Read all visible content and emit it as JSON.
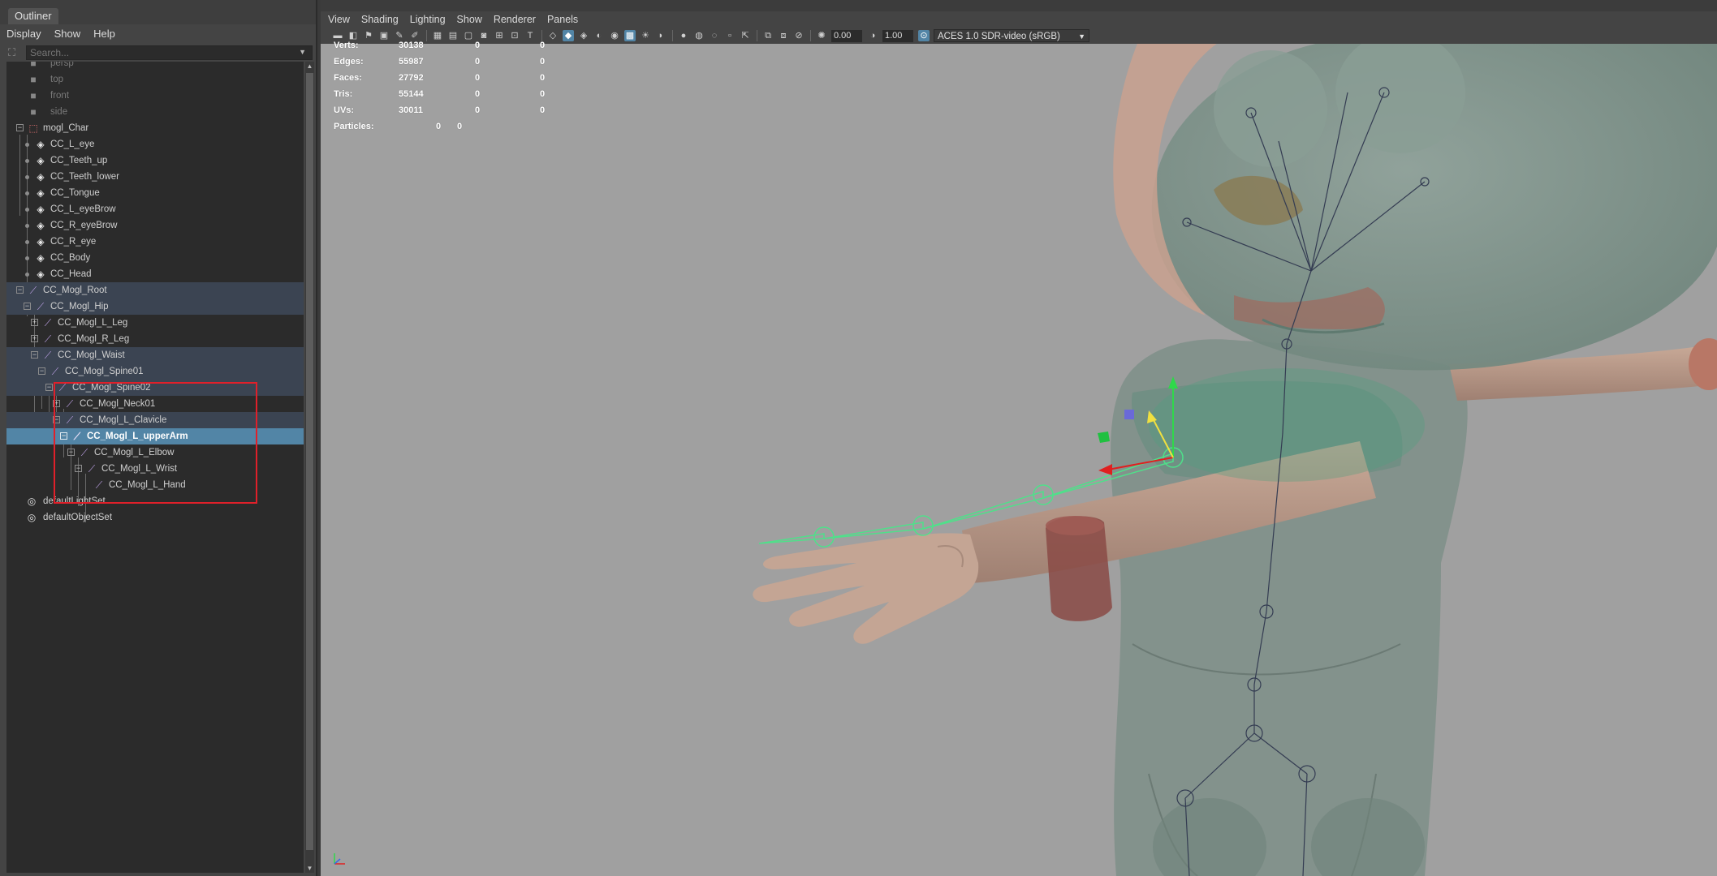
{
  "outliner": {
    "tab_label": "Outliner",
    "menu": [
      "Display",
      "Show",
      "Help"
    ],
    "search_placeholder": "Search...",
    "items": [
      {
        "label": "persp",
        "icon": "camera-icon"
      },
      {
        "label": "top",
        "icon": "camera-icon"
      },
      {
        "label": "front",
        "icon": "camera-icon"
      },
      {
        "label": "side",
        "icon": "camera-icon"
      },
      {
        "label": "mogl_Char",
        "icon": "group-icon"
      },
      {
        "label": "CC_L_eye",
        "icon": "mesh-icon"
      },
      {
        "label": "CC_Teeth_up",
        "icon": "mesh-icon"
      },
      {
        "label": "CC_Teeth_lower",
        "icon": "mesh-icon"
      },
      {
        "label": "CC_Tongue",
        "icon": "mesh-icon"
      },
      {
        "label": "CC_L_eyeBrow",
        "icon": "mesh-icon"
      },
      {
        "label": "CC_R_eyeBrow",
        "icon": "mesh-icon"
      },
      {
        "label": "CC_R_eye",
        "icon": "mesh-icon"
      },
      {
        "label": "CC_Body",
        "icon": "mesh-icon"
      },
      {
        "label": "CC_Head",
        "icon": "mesh-icon"
      },
      {
        "label": "CC_Mogl_Root",
        "icon": "joint-icon"
      },
      {
        "label": "CC_Mogl_Hip",
        "icon": "joint-icon"
      },
      {
        "label": "CC_Mogl_L_Leg",
        "icon": "joint-icon"
      },
      {
        "label": "CC_Mogl_R_Leg",
        "icon": "joint-icon"
      },
      {
        "label": "CC_Mogl_Waist",
        "icon": "joint-icon"
      },
      {
        "label": "CC_Mogl_Spine01",
        "icon": "joint-icon"
      },
      {
        "label": "CC_Mogl_Spine02",
        "icon": "joint-icon"
      },
      {
        "label": "CC_Mogl_Neck01",
        "icon": "joint-icon"
      },
      {
        "label": "CC_Mogl_L_Clavicle",
        "icon": "joint-icon"
      },
      {
        "label": "CC_Mogl_L_upperArm",
        "icon": "joint-icon"
      },
      {
        "label": "CC_Mogl_L_Elbow",
        "icon": "joint-icon"
      },
      {
        "label": "CC_Mogl_L_Wrist",
        "icon": "joint-icon"
      },
      {
        "label": "CC_Mogl_L_Hand",
        "icon": "joint-icon"
      },
      {
        "label": "defaultLightSet",
        "icon": "set-icon"
      },
      {
        "label": "defaultObjectSet",
        "icon": "set-icon"
      }
    ]
  },
  "viewport": {
    "menu": [
      "View",
      "Shading",
      "Lighting",
      "Show",
      "Renderer",
      "Panels"
    ],
    "exposure_value": "0.00",
    "gamma_value": "1.00",
    "color_space": "ACES 1.0 SDR-video (sRGB)",
    "hud": [
      {
        "label": "Verts:",
        "v1": "30138",
        "v2": "0",
        "v3": "0"
      },
      {
        "label": "Edges:",
        "v1": "55987",
        "v2": "0",
        "v3": "0"
      },
      {
        "label": "Faces:",
        "v1": "27792",
        "v2": "0",
        "v3": "0"
      },
      {
        "label": "Tris:",
        "v1": "55144",
        "v2": "0",
        "v3": "0"
      },
      {
        "label": "UVs:",
        "v1": "30011",
        "v2": "0",
        "v3": "0"
      },
      {
        "label": "Particles:",
        "v1": "0",
        "v2": "0"
      }
    ]
  },
  "colors": {
    "selection": "#5285a6",
    "highlight_box": "#e0202a",
    "joint_wire": "#4fe08a"
  }
}
